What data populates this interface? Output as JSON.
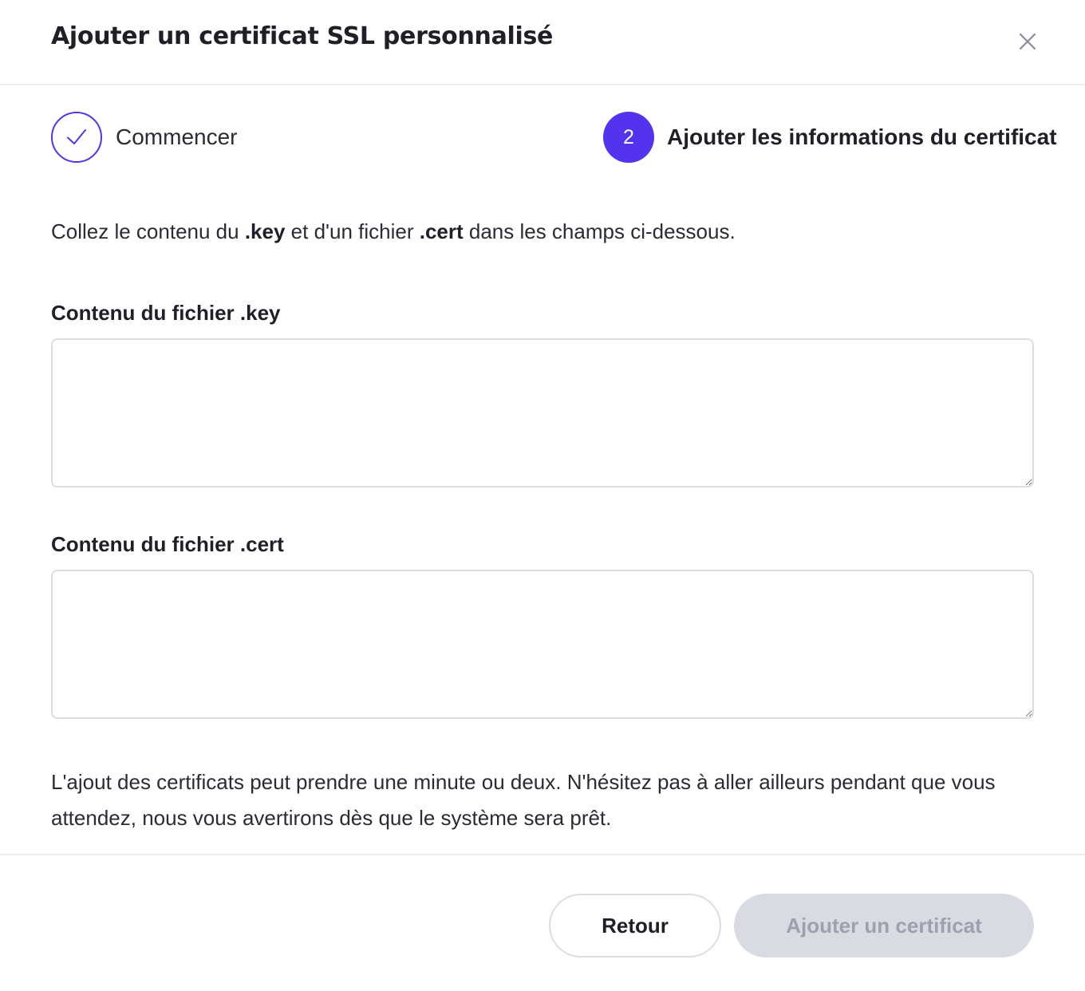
{
  "header": {
    "title": "Ajouter un certificat SSL personnalisé",
    "close_icon": "close-icon"
  },
  "stepper": {
    "steps": [
      {
        "label": "Commencer",
        "status": "completed",
        "icon": "checkmark-icon"
      },
      {
        "number": "2",
        "label": "Ajouter les informations du certificat",
        "status": "active"
      }
    ],
    "accent_color": "#5333ed"
  },
  "instruction": {
    "prefix": "Collez le contenu du ",
    "key_ext": ".key",
    "middle": " et d'un fichier ",
    "cert_ext": ".cert",
    "suffix": " dans les champs ci-dessous."
  },
  "fields": {
    "key": {
      "label": "Contenu du fichier .key",
      "value": ""
    },
    "cert": {
      "label": "Contenu du fichier .cert",
      "value": ""
    }
  },
  "note": "L'ajout des certificats peut prendre une minute ou deux. N'hésitez pas à aller ailleurs pendant que vous attendez, nous vous avertirons dès que le système sera prêt.",
  "footer": {
    "back_label": "Retour",
    "submit_label": "Ajouter un certificat",
    "submit_state": "disabled"
  }
}
